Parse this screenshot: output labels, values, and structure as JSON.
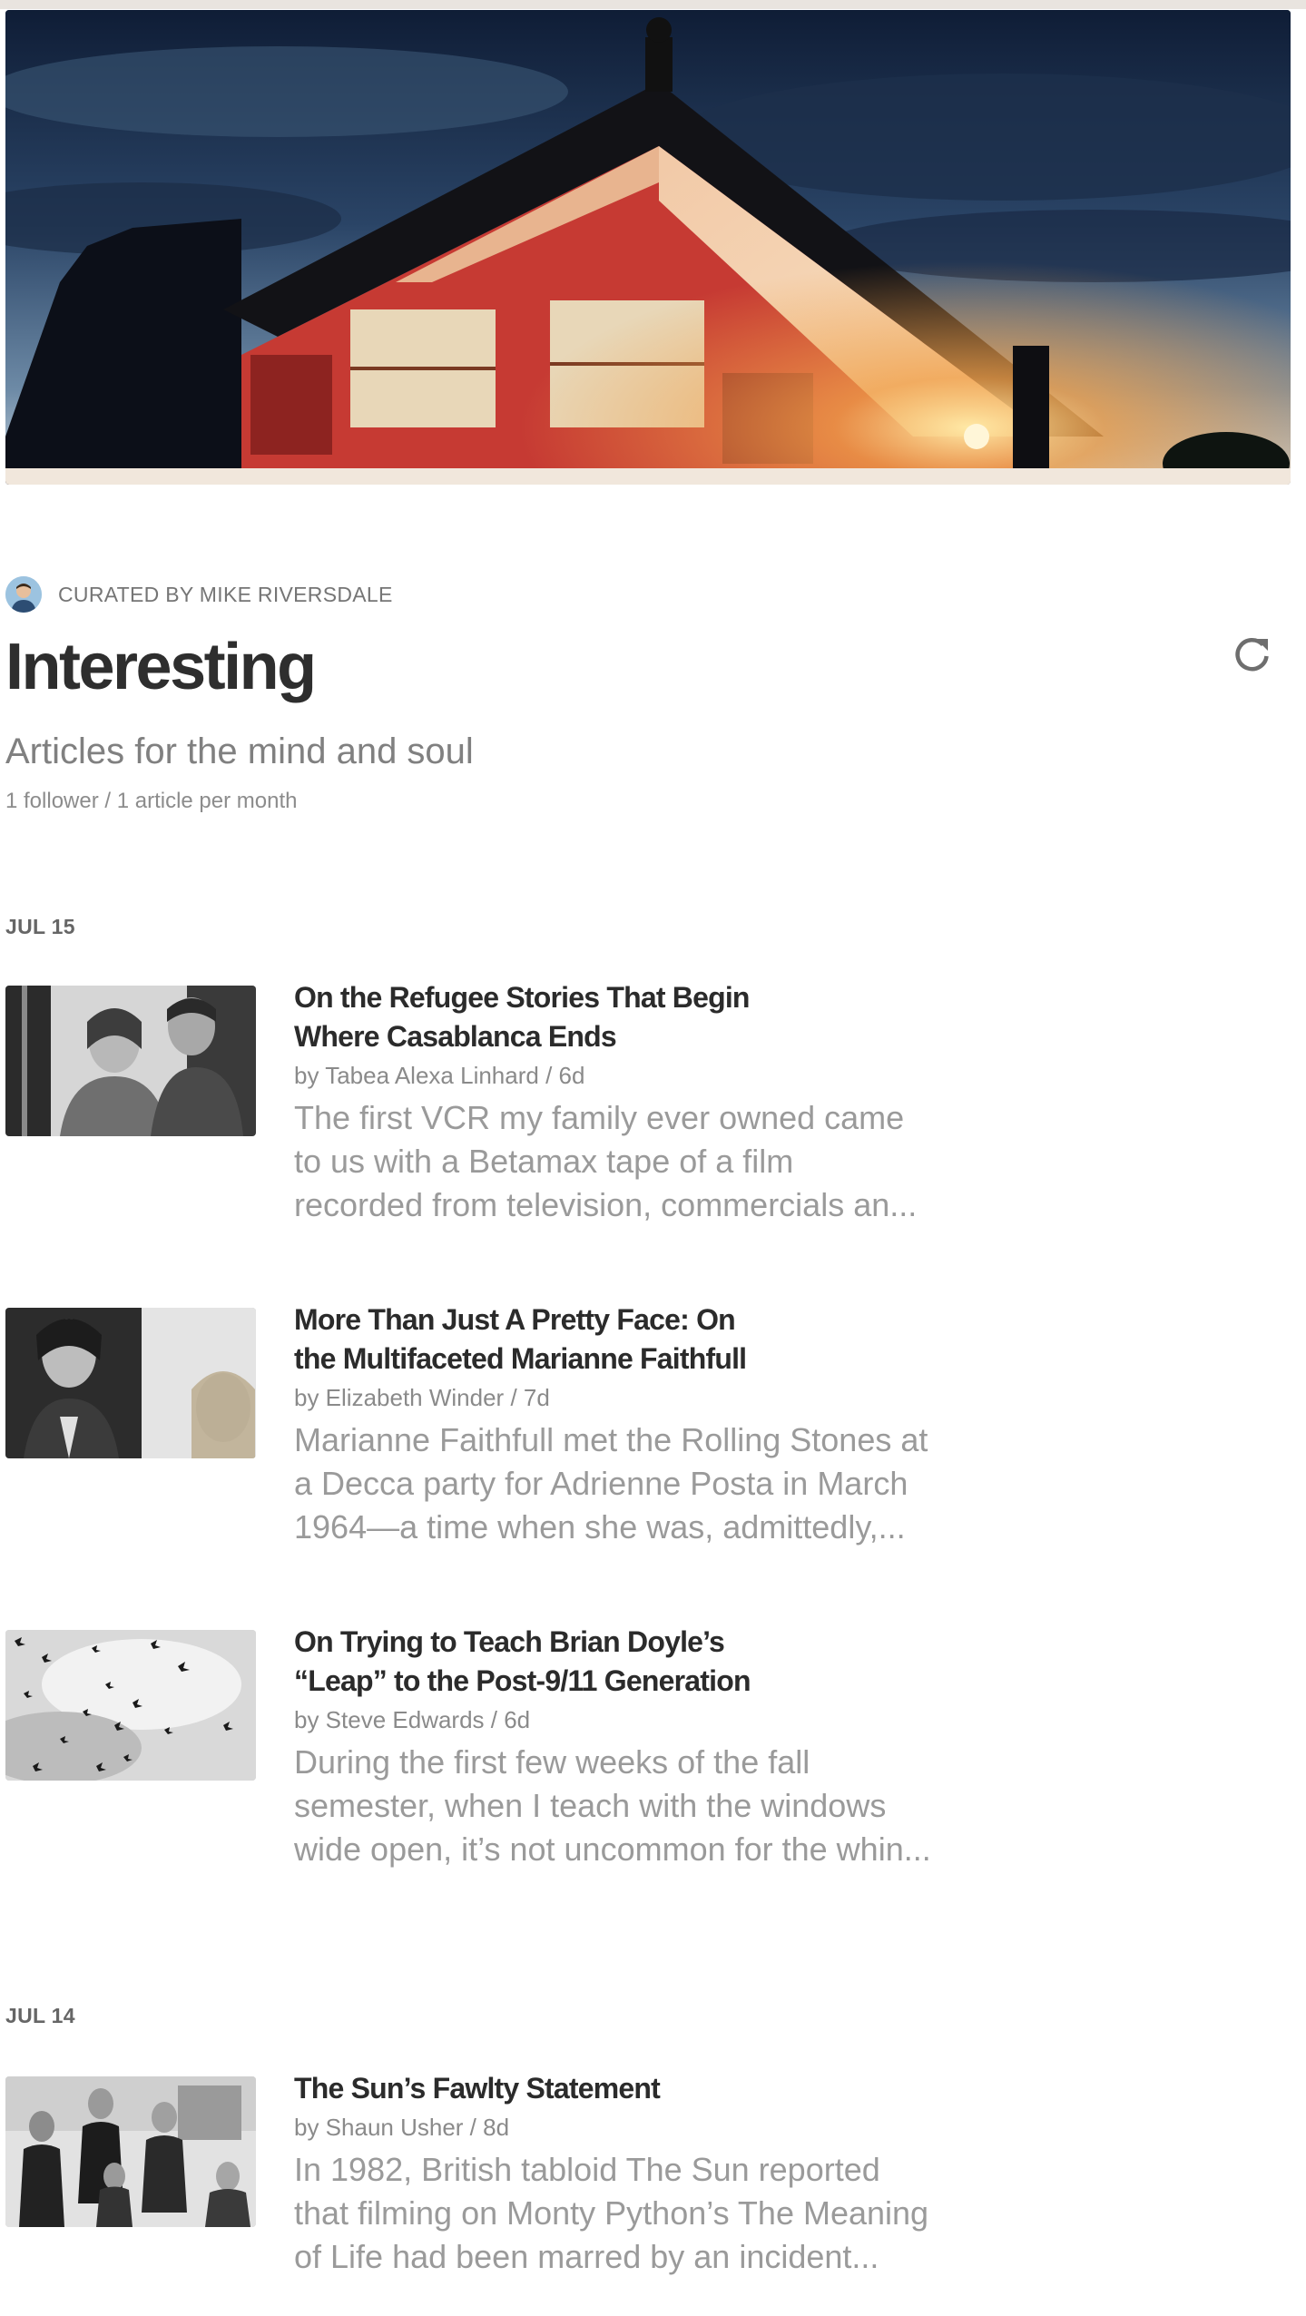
{
  "collection": {
    "curator_label": "CURATED BY MIKE RIVERSDALE",
    "title": "Interesting",
    "subtitle": "Articles for the mind and soul",
    "stats": "1 follower / 1 article per month",
    "refresh_icon": "refresh-icon"
  },
  "groups": [
    {
      "date": "JUL 15",
      "articles": [
        {
          "title_line1": "On the Refugee Stories That Begin",
          "title_line2": "Where Casablanca Ends",
          "meta": "by Tabea Alexa Linhard / 6d",
          "excerpt_line1": "The first VCR my family ever owned came",
          "excerpt_line2": "to us with a Betamax tape of a film",
          "excerpt_line3": "recorded from television, commercials an..."
        },
        {
          "title_line1": "More Than Just A Pretty Face: On",
          "title_line2": "the Multifaceted Marianne Faithfull",
          "meta": "by Elizabeth Winder / 7d",
          "excerpt_line1": "Marianne Faithfull met the Rolling Stones at",
          "excerpt_line2": "a Decca party for Adrienne Posta in March",
          "excerpt_line3": "1964—a time when she was, admittedly,..."
        },
        {
          "title_line1": "On Trying to Teach Brian Doyle’s",
          "title_line2": "“Leap” to the Post-9/11 Generation",
          "meta": "by Steve Edwards / 6d",
          "excerpt_line1": "During the first few weeks of the fall",
          "excerpt_line2": "semester, when I teach with the windows",
          "excerpt_line3": "wide open, it’s not uncommon for the whin..."
        }
      ]
    },
    {
      "date": "JUL 14",
      "articles": [
        {
          "title_line1": "The Sun’s Fawlty Statement",
          "meta": "by Shaun Usher / 8d",
          "excerpt_line1": "In 1982, British tabloid The Sun reported",
          "excerpt_line2": "that filming on Monty Python’s The Meaning",
          "excerpt_line3": "of Life had been marred by an incident..."
        }
      ]
    }
  ]
}
